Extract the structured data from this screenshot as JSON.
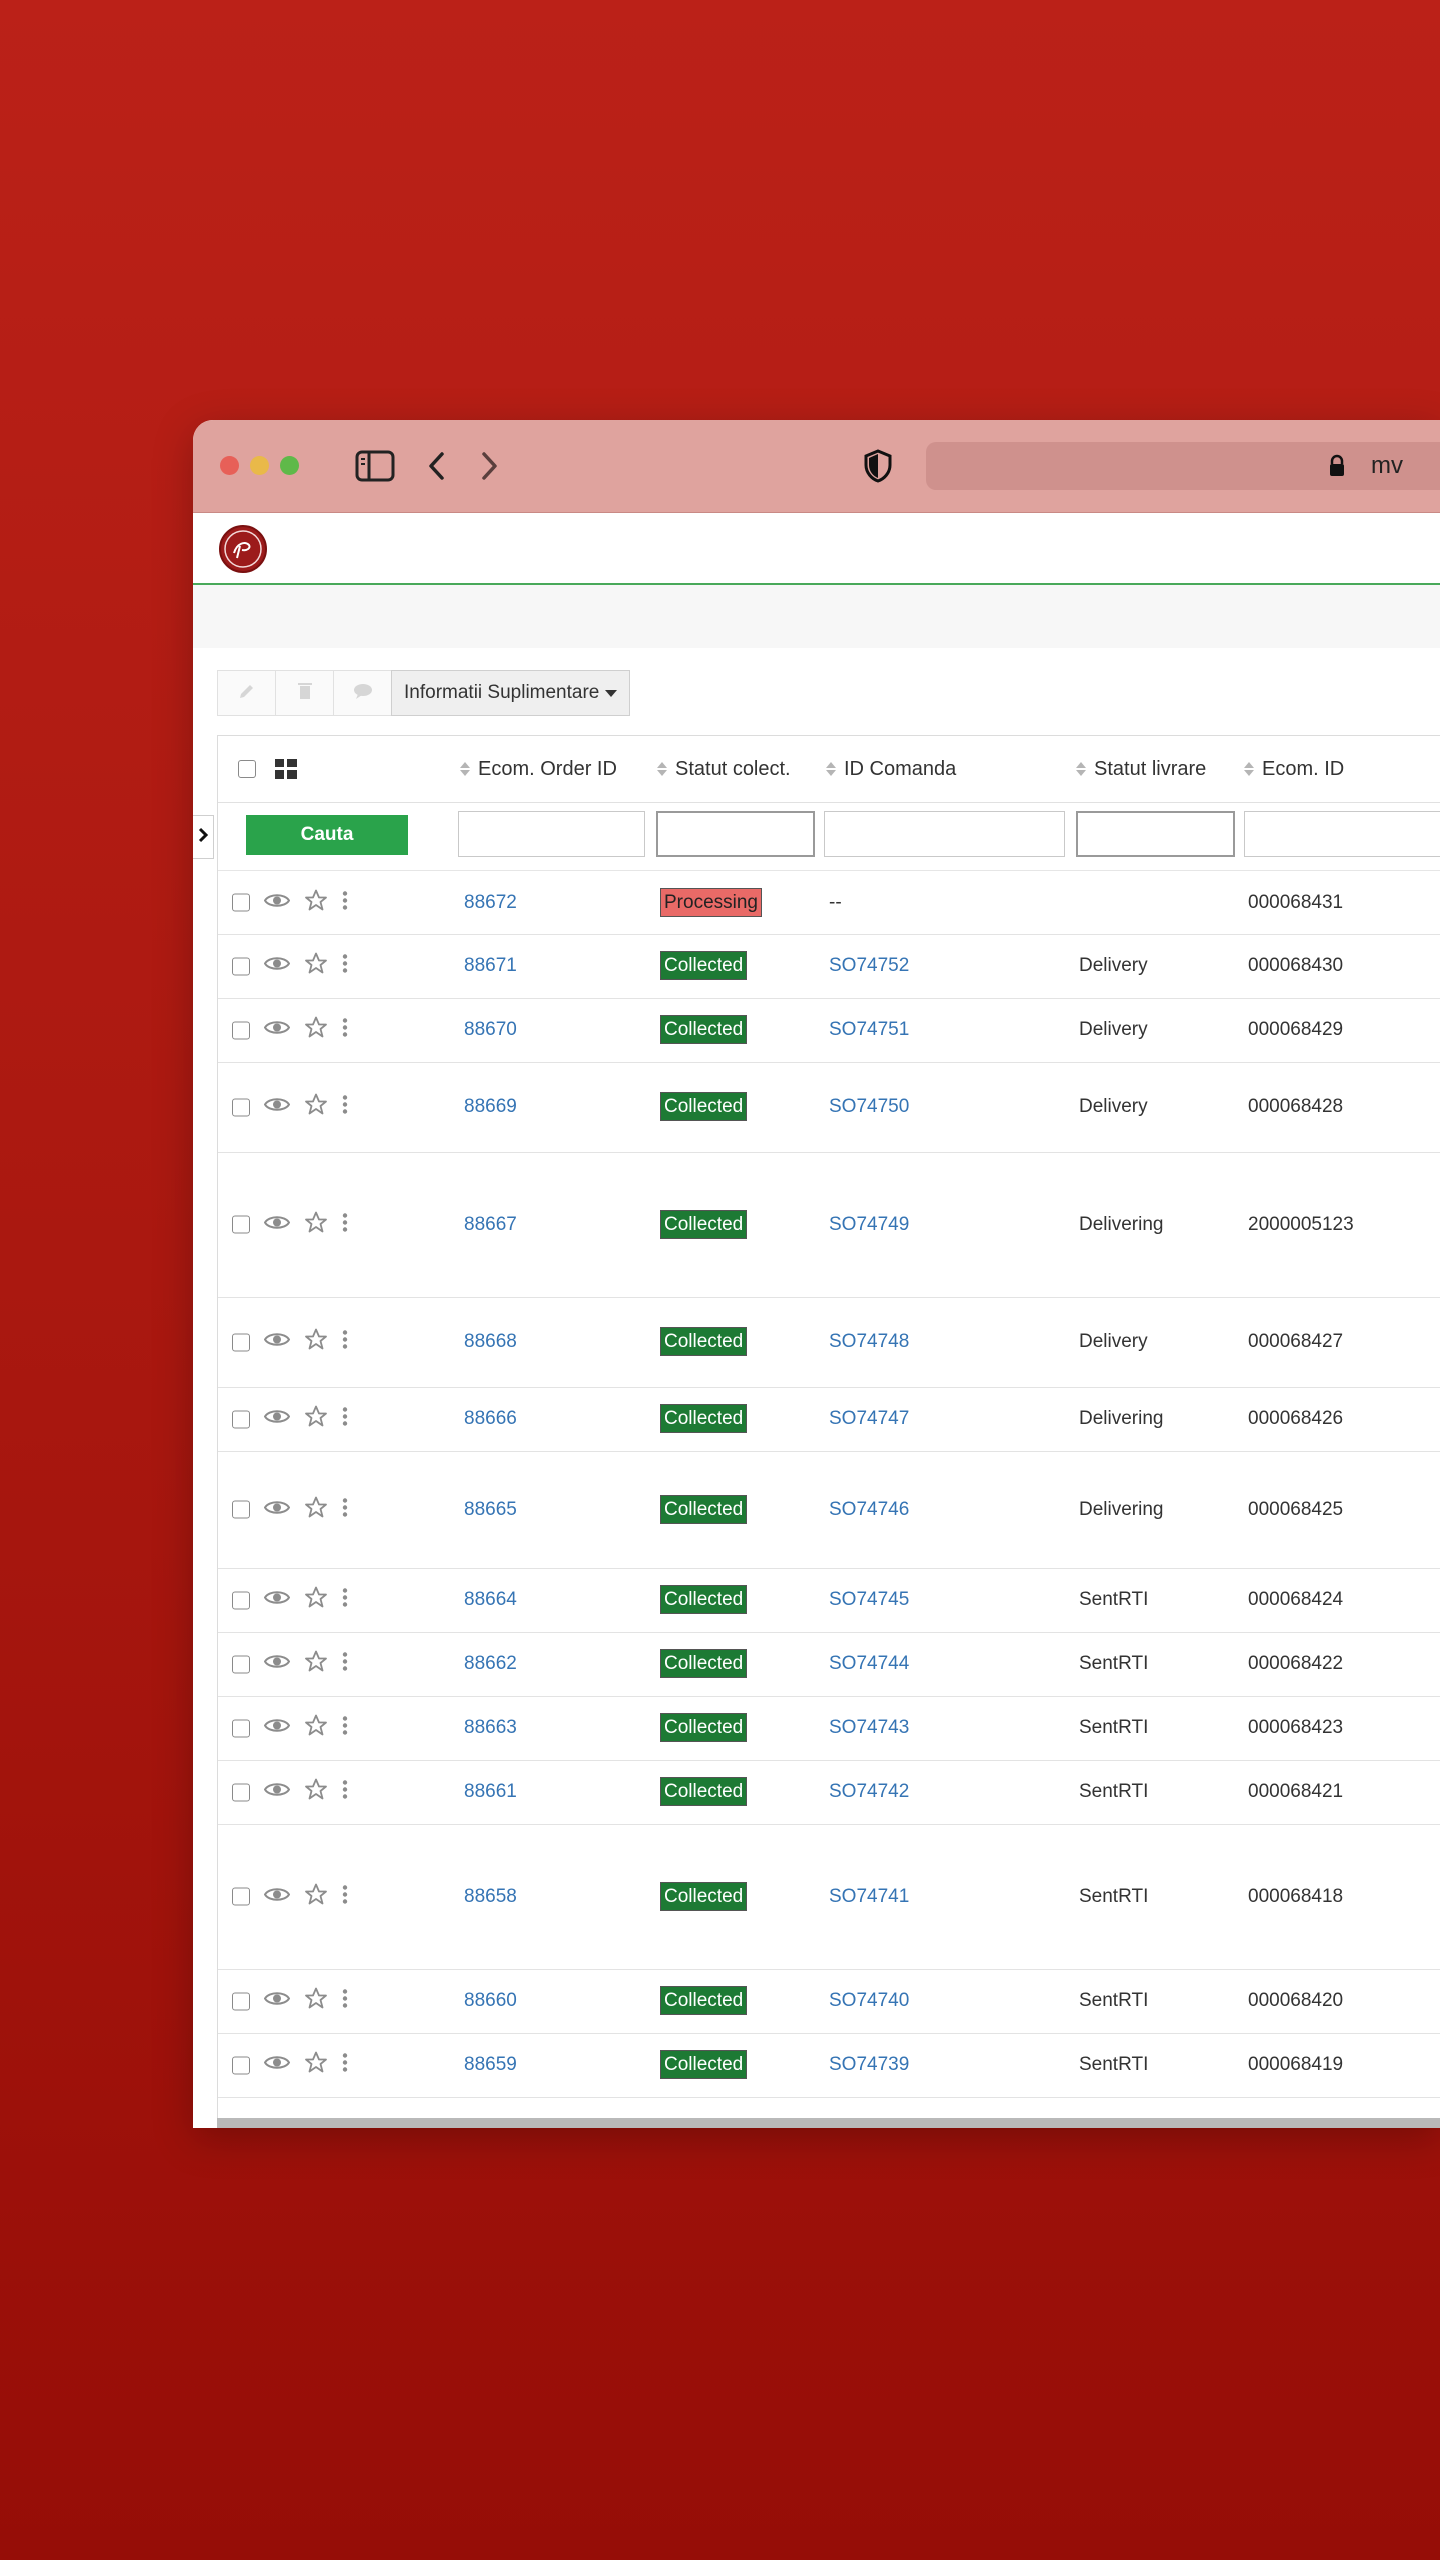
{
  "browser": {
    "url_text": "mv"
  },
  "toolbar": {
    "dropdown_label": "Informatii Suplimentare"
  },
  "table": {
    "columns": [
      "Ecom. Order ID",
      "Statut colect.",
      "ID Comanda",
      "Statut livrare",
      "Ecom. ID"
    ],
    "search_button": "Cauta",
    "rows": [
      {
        "order_id": "88672",
        "status": "Processing",
        "comanda": "--",
        "livrare": "",
        "ecom_id": "000068431"
      },
      {
        "order_id": "88671",
        "status": "Collected",
        "comanda": "SO74752",
        "livrare": "Delivery",
        "ecom_id": "000068430"
      },
      {
        "order_id": "88670",
        "status": "Collected",
        "comanda": "SO74751",
        "livrare": "Delivery",
        "ecom_id": "000068429"
      },
      {
        "order_id": "88669",
        "status": "Collected",
        "comanda": "SO74750",
        "livrare": "Delivery",
        "ecom_id": "000068428"
      },
      {
        "order_id": "88667",
        "status": "Collected",
        "comanda": "SO74749",
        "livrare": "Delivering",
        "ecom_id": "2000005123"
      },
      {
        "order_id": "88668",
        "status": "Collected",
        "comanda": "SO74748",
        "livrare": "Delivery",
        "ecom_id": "000068427"
      },
      {
        "order_id": "88666",
        "status": "Collected",
        "comanda": "SO74747",
        "livrare": "Delivering",
        "ecom_id": "000068426"
      },
      {
        "order_id": "88665",
        "status": "Collected",
        "comanda": "SO74746",
        "livrare": "Delivering",
        "ecom_id": "000068425"
      },
      {
        "order_id": "88664",
        "status": "Collected",
        "comanda": "SO74745",
        "livrare": "SentRTI",
        "ecom_id": "000068424"
      },
      {
        "order_id": "88662",
        "status": "Collected",
        "comanda": "SO74744",
        "livrare": "SentRTI",
        "ecom_id": "000068422"
      },
      {
        "order_id": "88663",
        "status": "Collected",
        "comanda": "SO74743",
        "livrare": "SentRTI",
        "ecom_id": "000068423"
      },
      {
        "order_id": "88661",
        "status": "Collected",
        "comanda": "SO74742",
        "livrare": "SentRTI",
        "ecom_id": "000068421"
      },
      {
        "order_id": "88658",
        "status": "Collected",
        "comanda": "SO74741",
        "livrare": "SentRTI",
        "ecom_id": "000068418"
      },
      {
        "order_id": "88660",
        "status": "Collected",
        "comanda": "SO74740",
        "livrare": "SentRTI",
        "ecom_id": "000068420"
      },
      {
        "order_id": "88659",
        "status": "Collected",
        "comanda": "SO74739",
        "livrare": "SentRTI",
        "ecom_id": "000068419"
      }
    ]
  },
  "colors": {
    "collected": "#1d7a34",
    "processing": "#e96a67",
    "link": "#3574b4",
    "search_button": "#2aa34b"
  }
}
